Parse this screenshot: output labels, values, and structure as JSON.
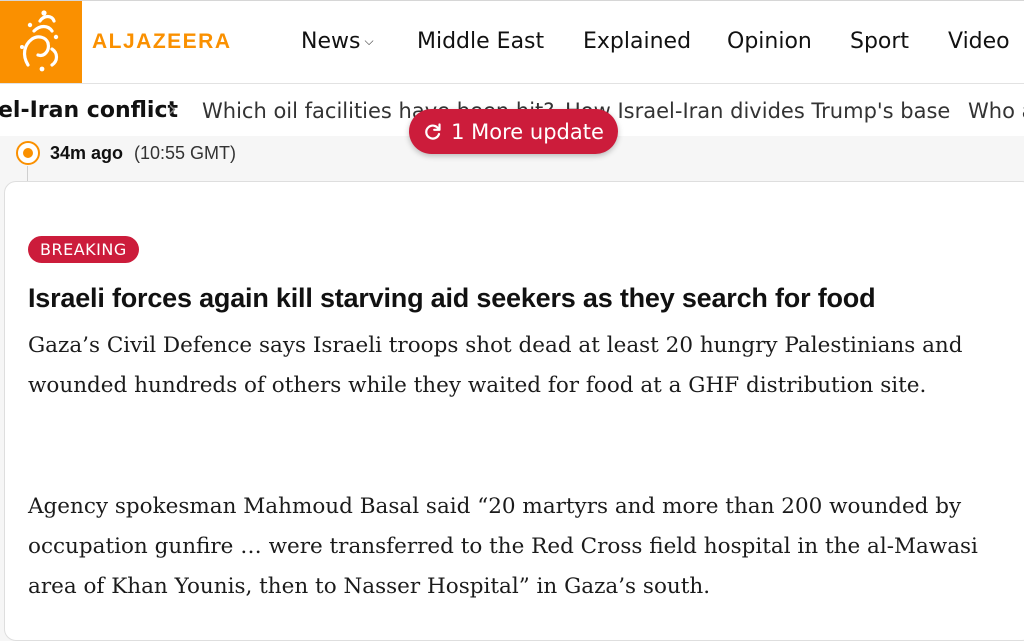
{
  "header": {
    "logo_text": "ALJAZEERA",
    "nav": [
      {
        "label": "News",
        "has_dropdown": true
      },
      {
        "label": "Middle East"
      },
      {
        "label": "Explained"
      },
      {
        "label": "Opinion"
      },
      {
        "label": "Sport"
      },
      {
        "label": "Video"
      }
    ]
  },
  "topics": {
    "title": "el-Iran conflict",
    "links": [
      "Which oil facilities have been hit?",
      "How Israel-Iran divides Trump's base",
      "Who a"
    ]
  },
  "update_button": {
    "label": "1 More update"
  },
  "post": {
    "time_relative": "34m ago",
    "time_absolute": "(10:55 GMT)",
    "badge": "BREAKING",
    "headline": "Israeli forces again kill starving aid seekers as they search for food",
    "paragraphs": [
      "Gaza’s Civil Defence says Israeli troops shot dead at least 20 hungry Palestinians and wounded hundreds of others while they waited for food at a GHF distribution site.",
      "Agency spokesman Mahmoud Basal said “20 martyrs and more than 200 wounded by occupation gunfire … were transferred to the Red Cross field hospital in the al-Mawasi area of Khan Younis, then to Nasser Hospital” in Gaza’s south."
    ]
  },
  "colors": {
    "brand": "#fa9000",
    "breaking": "#cc1c3b"
  }
}
